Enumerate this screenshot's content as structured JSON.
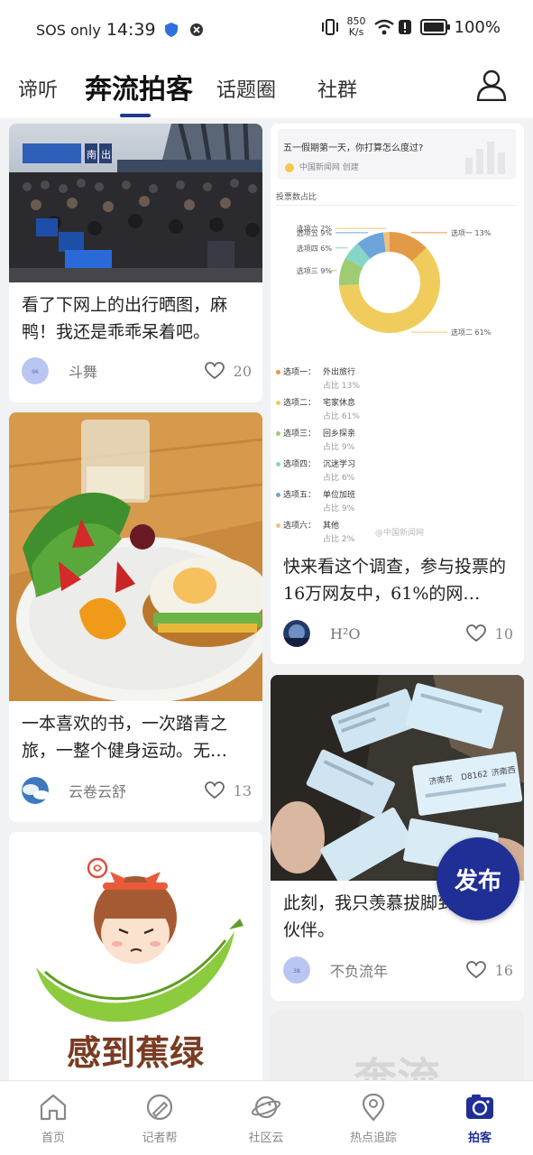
{
  "status_bar": {
    "carrier": "SOS only",
    "time": "14:39",
    "net_speed_value": "850",
    "net_speed_unit": "K/s",
    "battery": "100%",
    "icons": [
      "shield-icon",
      "close-circle-icon",
      "vibrate-icon",
      "wifi-icon",
      "alert-icon",
      "battery-icon"
    ]
  },
  "top_tabs": [
    {
      "label": "谛听"
    },
    {
      "label": "奔流拍客",
      "active": true
    },
    {
      "label": "话题圈"
    },
    {
      "label": "社群"
    }
  ],
  "cards": {
    "train_station": {
      "title": "看了下网上的出行晒图，麻鸭！我还是乖乖呆着吧。",
      "author": "斗舞",
      "likes": "20",
      "image_signs": [
        "南",
        "出"
      ]
    },
    "poll": {
      "question": "五一假期第一天，你打算怎么度过?",
      "source": "中国新闻网 创建",
      "subtitle": "投票数占比",
      "options": [
        {
          "label": "选项一：",
          "name": "外出旅行",
          "pct_text": "占比 13%",
          "pct": 13,
          "color": "#e39a46"
        },
        {
          "label": "选项二：",
          "name": "宅家休息",
          "pct_text": "占比 61%",
          "pct": 61,
          "color": "#f0cc5c"
        },
        {
          "label": "选项三：",
          "name": "回乡探亲",
          "pct_text": "占比 9%",
          "pct": 9,
          "color": "#9fcc72"
        },
        {
          "label": "选项四：",
          "name": "沉迷学习",
          "pct_text": "占比 6%",
          "pct": 6,
          "color": "#86d6c8"
        },
        {
          "label": "选项五：",
          "name": "单位加班",
          "pct_text": "占比 9%",
          "pct": 9,
          "color": "#6ea4dc"
        },
        {
          "label": "选项六：",
          "name": "其他",
          "pct_text": "占比 2%",
          "pct": 2,
          "color": "#eec07a"
        }
      ],
      "pie_labels": [
        "选项一 13%",
        "选项二 61%",
        "选项三 9%",
        "选项四 6%",
        "选项五 9%",
        "选项六 2%"
      ],
      "watermark": "@中国新闻网",
      "title": "快来看这个调查，参与投票的16万网友中，61%的网…",
      "author": "H²O",
      "likes": "10"
    },
    "breakfast": {
      "title": "一本喜欢的书，一次踏青之旅，一整个健身运动。无…",
      "author": "云卷云舒",
      "likes": "13"
    },
    "tickets": {
      "title": "此刻，我只羡慕拔脚到济南小伙伴。",
      "author": "不负流年",
      "likes": "16",
      "ticket_texts": [
        "济南东",
        "D8162",
        "济南西"
      ]
    },
    "banana": {
      "image_caption": "感到蕉绿"
    },
    "placeholder": {
      "logo_text": "奔流"
    }
  },
  "publish_button": "发布",
  "bottom_nav": [
    {
      "label": "首页",
      "icon": "home-icon"
    },
    {
      "label": "记者帮",
      "icon": "reporter-icon"
    },
    {
      "label": "社区云",
      "icon": "planet-icon"
    },
    {
      "label": "热点追踪",
      "icon": "location-pin-icon"
    },
    {
      "label": "拍客",
      "icon": "camera-icon",
      "active": true
    }
  ],
  "colors": {
    "accent": "#1f2f95",
    "tab_underline": "#1e3a8a",
    "background": "#f1f2f4"
  }
}
